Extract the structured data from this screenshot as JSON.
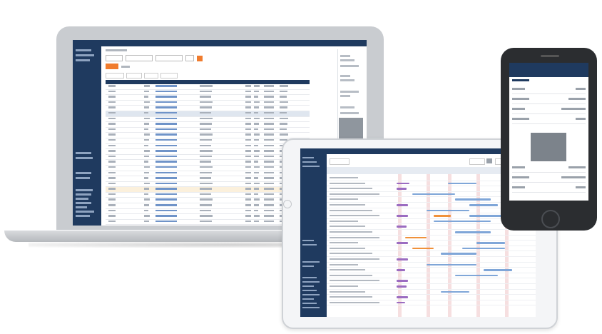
{
  "colors": {
    "navy": "#1f3a5f",
    "accent_orange": "#f07c2e",
    "link_blue": "#6f93c8",
    "gantt_purple": "#9b6cc1",
    "gantt_blue": "#7fa6d8",
    "gantt_orange": "#f0913a"
  },
  "devices": {
    "laptop": {
      "app_logo": "",
      "nav": [
        "",
        "",
        "",
        ""
      ]
    },
    "tablet": {
      "app_logo": "",
      "nav": [
        "",
        "",
        "",
        ""
      ]
    },
    "phone": {
      "nav_back": "",
      "nav_title": "",
      "nav_right": ""
    }
  }
}
